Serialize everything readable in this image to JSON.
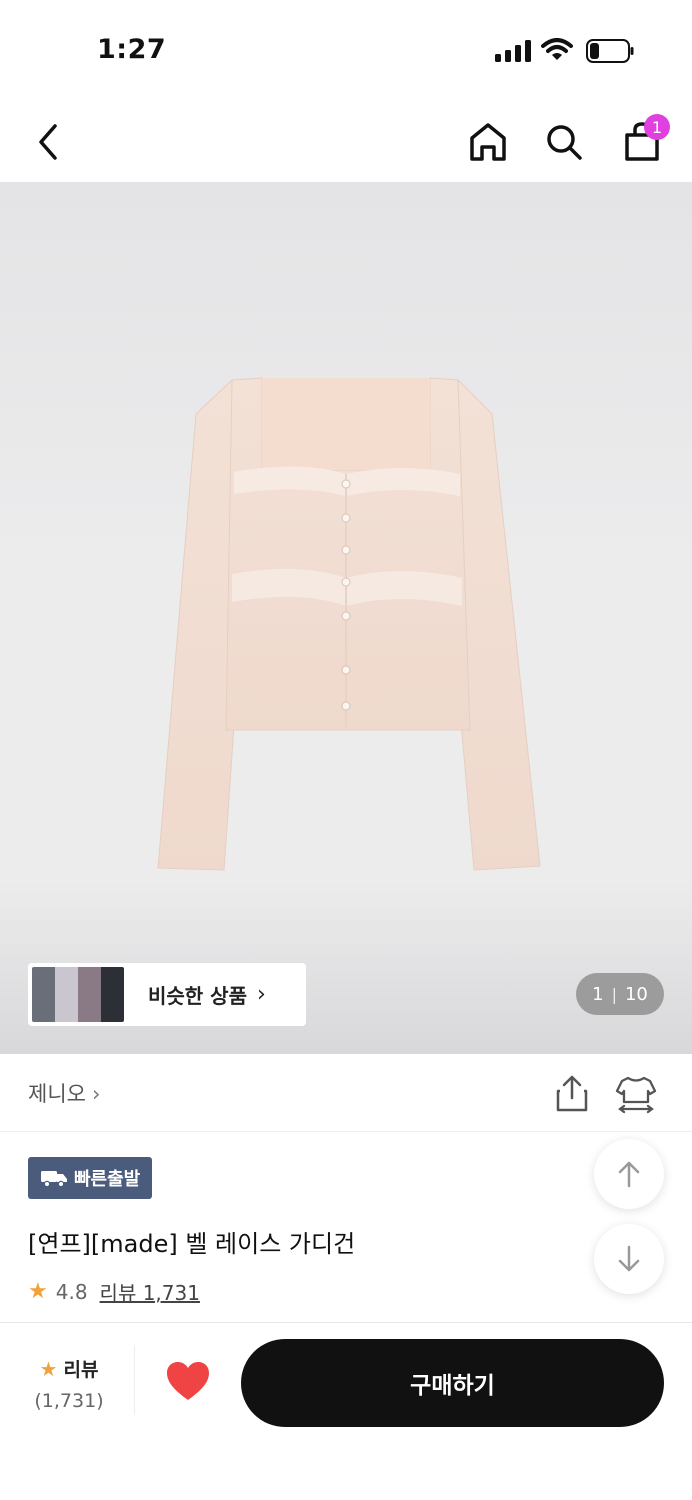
{
  "status_bar": {
    "time": "1:27"
  },
  "nav": {
    "cart_count": "1"
  },
  "gallery": {
    "similar_label": "비슷한 상품",
    "similar_chevron": "›",
    "current_page": "1",
    "separator": "|",
    "total_pages": "10"
  },
  "brand": {
    "name": "제니오",
    "chevron": "›"
  },
  "product": {
    "fast_badge": "빠른출발",
    "title": "[연프][made] 벨 레이스 가디건",
    "rating": "4.8",
    "review_link": "리뷰 1,731"
  },
  "bottom_bar": {
    "review_label": "리뷰",
    "review_count": "(1,731)",
    "buy_label": "구매하기"
  },
  "icons": {
    "back": "chevron-left-icon",
    "home": "home-icon",
    "search": "search-icon",
    "cart": "shopping-bag-icon",
    "share": "share-icon",
    "size": "size-guide-icon",
    "truck": "truck-icon",
    "star": "star-icon",
    "heart": "heart-icon",
    "arrow_up": "arrow-up-icon",
    "arrow_down": "arrow-down-icon"
  },
  "colors": {
    "accent_badge": "#e040e0",
    "fast_badge_bg": "#4b5b7c",
    "star": "#f2a23a",
    "heart": "#f04444",
    "buy_button": "#111111",
    "cardigan": "#f1ddd2"
  }
}
